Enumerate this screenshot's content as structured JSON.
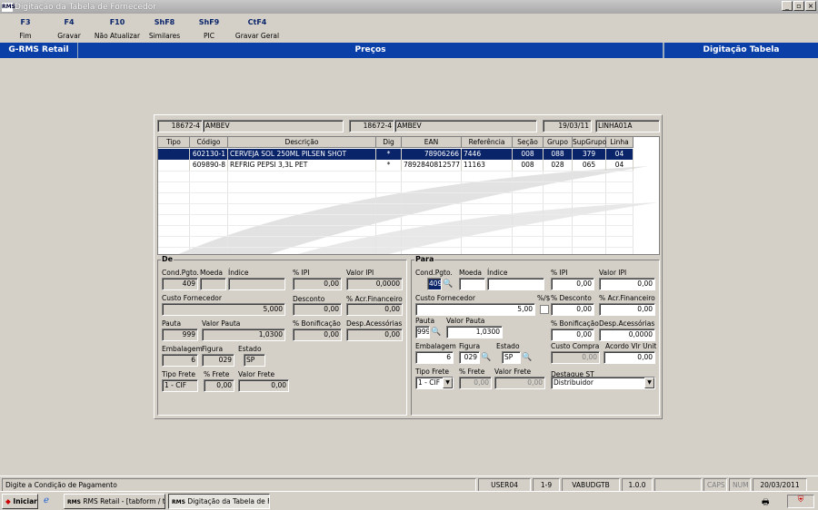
{
  "window": {
    "title": "Digitação da Tabela de Fornecedor",
    "app_icon": "rms-logo-icon"
  },
  "toolbar": [
    {
      "key": "F3",
      "label": "Fim"
    },
    {
      "key": "F4",
      "label": "Gravar"
    },
    {
      "key": "F10",
      "label": "Não Atualizar"
    },
    {
      "key": "ShF8",
      "label": "Similares"
    },
    {
      "key": "ShF9",
      "label": "PIC"
    },
    {
      "key": "CtF4",
      "label": "Gravar Geral"
    }
  ],
  "bluebar": {
    "app": "G-RMS Retail",
    "section": "Preços",
    "screen": "Digitação Tabela"
  },
  "header": {
    "supplier1_code": "18672-4",
    "supplier1_name": "AMBEV",
    "supplier2_code": "18672-4",
    "supplier2_name": "AMBEV",
    "date": "19/03/11",
    "line": "LINHA01A"
  },
  "grid": {
    "columns": [
      "Tipo",
      "Código",
      "Descrição",
      "Dig",
      "EAN",
      "Referência",
      "Seção",
      "Grupo",
      "SupGrupo",
      "Linha"
    ],
    "rows": [
      [
        "",
        "602130-1",
        "CERVEJA SOL 250ML PILSEN SHOT",
        "*",
        "78906266",
        "7446",
        "008",
        "088",
        "379",
        "04"
      ],
      [
        "",
        "609890-8",
        "REFRIG PEPSI 3,3L PET",
        "*",
        "7892840812577",
        "11163",
        "008",
        "028",
        "065",
        "04"
      ]
    ]
  },
  "de": {
    "title": "De",
    "labels": {
      "cond": "Cond.Pgto.",
      "moeda": "Moeda",
      "indice": "Índice",
      "pipi": "% IPI",
      "vipi": "Valor IPI",
      "custo": "Custo Fornecedor",
      "desc": "Desconto",
      "acr": "% Acr.Financeiro",
      "pauta": "Pauta",
      "vpauta": "Valor Pauta",
      "bonif": "% Bonificação",
      "desp": "Desp.Acessórias",
      "emb": "Embalagem",
      "fig": "Figura",
      "estado": "Estado",
      "tfrete": "Tipo Frete",
      "pfrete": "% Frete",
      "vfrete": "Valor Frete"
    },
    "values": {
      "cond": "409",
      "moeda": "",
      "indice": "",
      "pipi": "0,00",
      "vipi": "0,0000",
      "custo": "5,000",
      "desc": "0,00",
      "acr": "0,00",
      "pauta": "999",
      "vpauta": "1,0300",
      "bonif": "0,00",
      "desp": "0,00",
      "emb": "6",
      "fig": "029",
      "estado": "SP",
      "tfrete": "1 - CIF",
      "pfrete": "0,00",
      "vfrete": "0,00"
    }
  },
  "para": {
    "title": "Para",
    "labels": {
      "cond": "Cond.Pgto.",
      "moeda": "Moeda",
      "indice": "Índice",
      "pipi": "% IPI",
      "vipi": "Valor IPI",
      "custo": "Custo Fornecedor",
      "pctflag": "%/$",
      "desc": "% Desconto",
      "acr": "% Acr.Financeiro",
      "pauta": "Pauta",
      "vpauta": "Valor Pauta",
      "bonif": "% Bonificação",
      "desp": "Desp.Acessórias",
      "emb": "Embalagem",
      "fig": "Figura",
      "estado": "Estado",
      "ccompra": "Custo Compra",
      "acordo": "Acordo Vlr Unit",
      "tfrete": "Tipo Frete",
      "pfrete": "% Frete",
      "vfrete": "Valor Frete",
      "destaque": "Destaque ST"
    },
    "values": {
      "cond": "409",
      "moeda": "",
      "indice": "",
      "pipi": "0,00",
      "vipi": "0,00",
      "custo": "5,00",
      "desc": "0,00",
      "acr": "0,00",
      "pauta": "999",
      "vpauta": "1,0300",
      "bonif": "0,00",
      "desp": "0,0000",
      "emb": "6",
      "fig": "029",
      "estado": "SP",
      "ccompra": "0,00",
      "acordo": "0,00",
      "tfrete": "1 - CIF",
      "pfrete": "0,00",
      "vfrete": "0,00",
      "destaque": "Distribuidor"
    }
  },
  "status": {
    "message": "Digite a Condição de Pagamento",
    "user": "USER04",
    "pos": "1-9",
    "db": "VABUDGTB",
    "ver": "1.0.0",
    "caps": "CAPS",
    "num": "NUM",
    "date": "20/03/2011"
  },
  "taskbar": {
    "start": "Iniciar",
    "task1": "RMS Retail - [tabform / t...",
    "task2": "Digitação da Tabela de F..."
  },
  "colors": {
    "accent": "#0a3fa8",
    "selection": "#0a246a"
  }
}
